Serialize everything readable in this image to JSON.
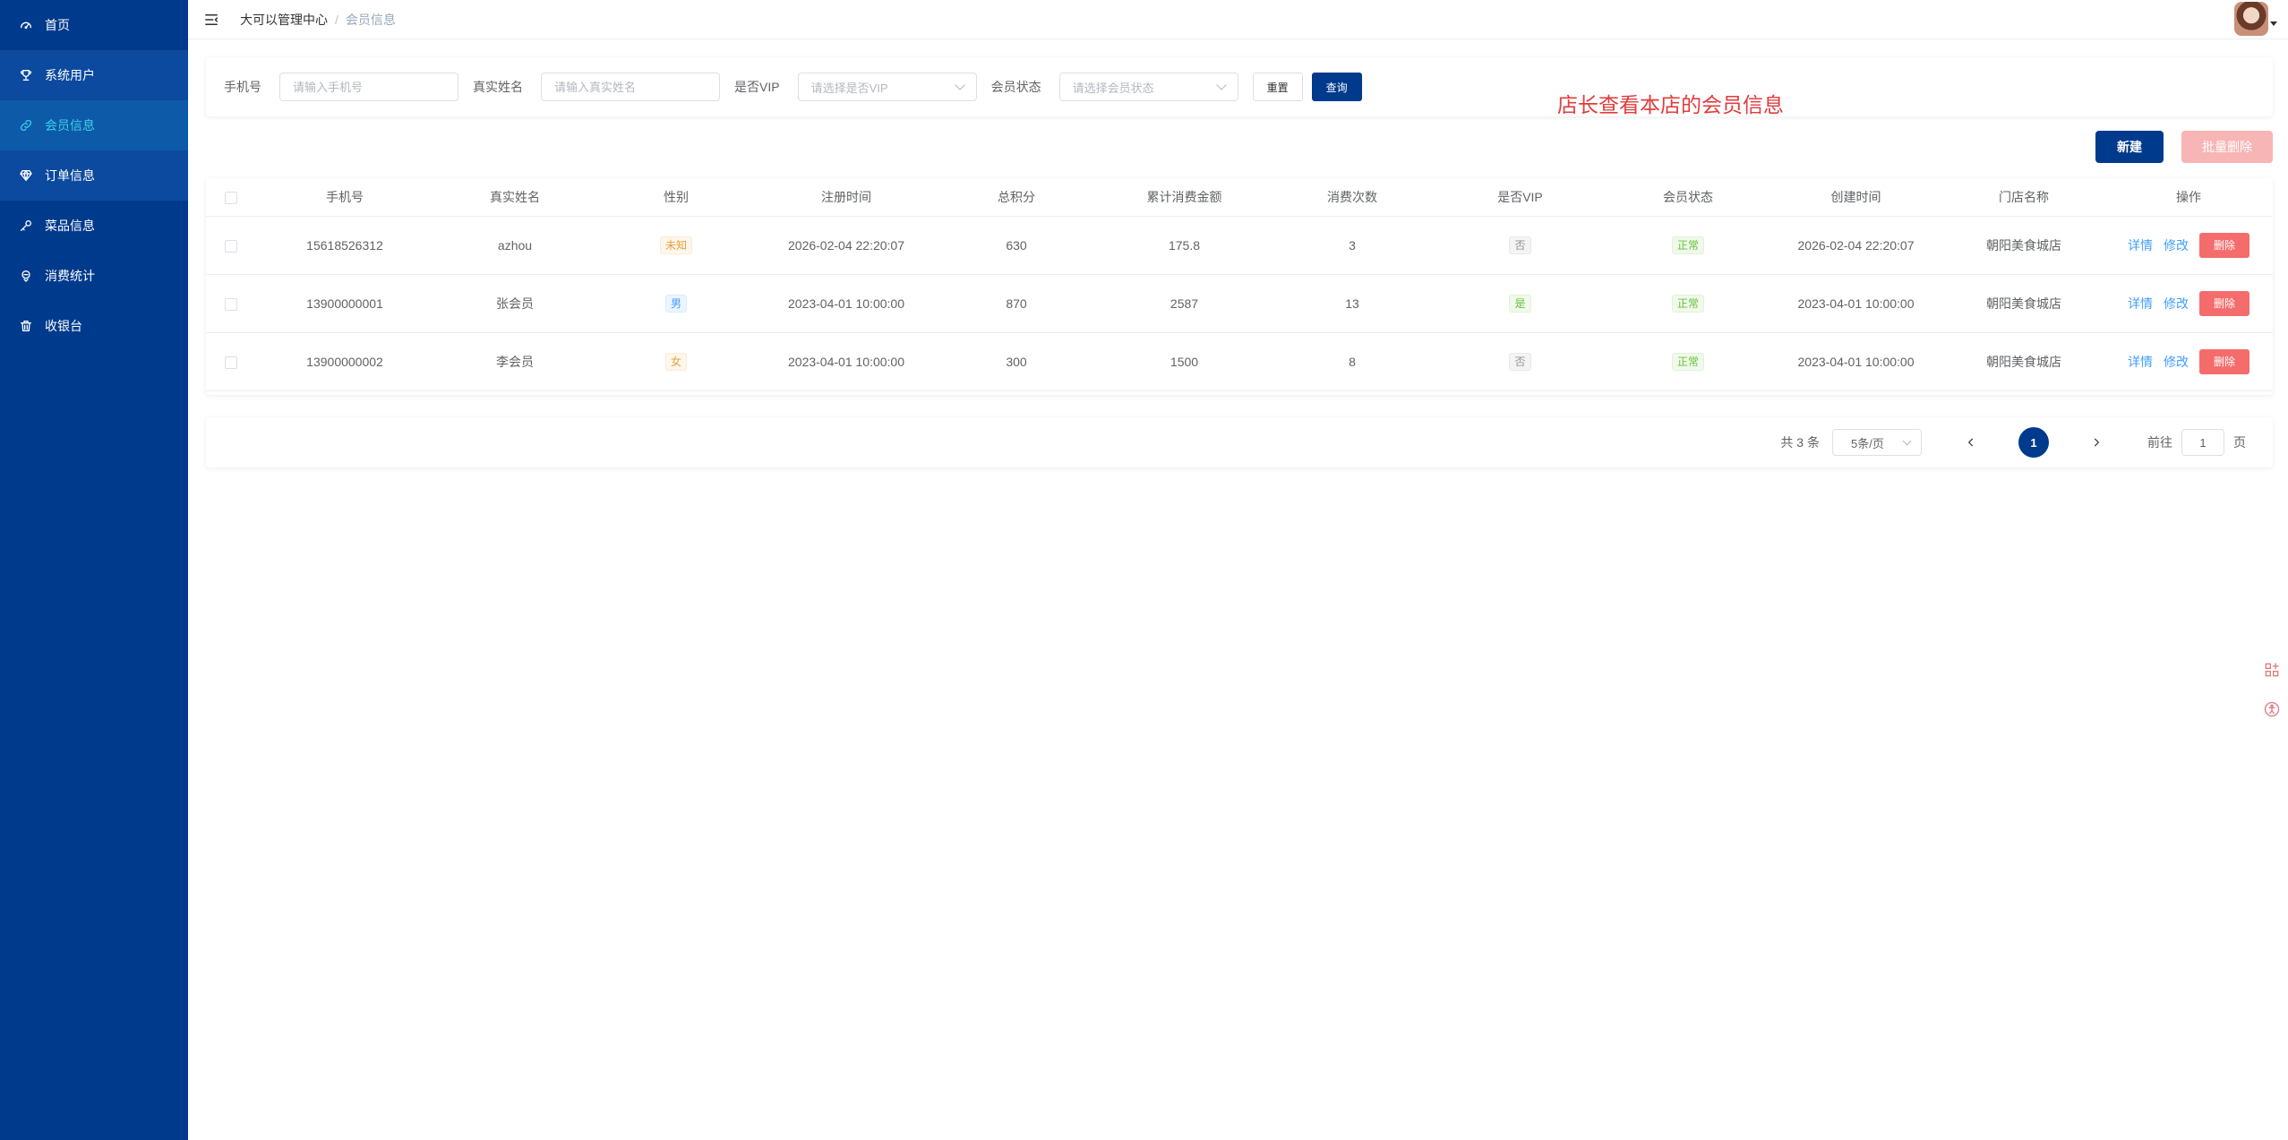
{
  "sidebar": {
    "items": [
      {
        "label": "首页",
        "icon": "dashboard-icon"
      },
      {
        "label": "系统用户",
        "icon": "trophy-icon"
      },
      {
        "label": "会员信息",
        "icon": "link-icon"
      },
      {
        "label": "订单信息",
        "icon": "diamond-icon"
      },
      {
        "label": "菜品信息",
        "icon": "key-icon"
      },
      {
        "label": "消费统计",
        "icon": "chart-icon"
      },
      {
        "label": "收银台",
        "icon": "trash-icon"
      }
    ]
  },
  "header": {
    "breadcrumb_root": "大可以管理中心",
    "breadcrumb_sep": "/",
    "breadcrumb_current": "会员信息"
  },
  "search": {
    "phone_label": "手机号",
    "phone_placeholder": "请输入手机号",
    "name_label": "真实姓名",
    "name_placeholder": "请输入真实姓名",
    "vip_label": "是否VIP",
    "vip_placeholder": "请选择是否VIP",
    "status_label": "会员状态",
    "status_placeholder": "请选择会员状态",
    "reset_label": "重置",
    "query_label": "查询"
  },
  "notice": "店长查看本店的会员信息",
  "actions": {
    "new_label": "新建",
    "batch_delete_label": "批量删除"
  },
  "table": {
    "columns": [
      "手机号",
      "真实姓名",
      "性别",
      "注册时间",
      "总积分",
      "累计消费金额",
      "消费次数",
      "是否VIP",
      "会员状态",
      "创建时间",
      "门店名称",
      "操作"
    ],
    "rows": [
      {
        "phone": "15618526312",
        "name": "azhou",
        "gender": "未知",
        "reg_time": "2026-02-04 22:20:07",
        "points": "630",
        "total_spend": "175.8",
        "visits": "3",
        "vip": "否",
        "status": "正常",
        "created": "2026-02-04 22:20:07",
        "store": "朝阳美食城店"
      },
      {
        "phone": "13900000001",
        "name": "张会员",
        "gender": "男",
        "reg_time": "2023-04-01 10:00:00",
        "points": "870",
        "total_spend": "2587",
        "visits": "13",
        "vip": "是",
        "status": "正常",
        "created": "2023-04-01 10:00:00",
        "store": "朝阳美食城店"
      },
      {
        "phone": "13900000002",
        "name": "李会员",
        "gender": "女",
        "reg_time": "2023-04-01 10:00:00",
        "points": "300",
        "total_spend": "1500",
        "visits": "8",
        "vip": "否",
        "status": "正常",
        "created": "2023-04-01 10:00:00",
        "store": "朝阳美食城店"
      }
    ],
    "op_detail": "详情",
    "op_edit": "修改",
    "op_delete": "删除"
  },
  "pagination": {
    "total_text": "共 3 条",
    "page_size": "5条/页",
    "current_page": "1",
    "goto_label": "前往",
    "goto_value": "1",
    "page_suffix": "页"
  },
  "colors": {
    "sidebar_bg": "#003a8c",
    "primary": "#003a8c",
    "active_text": "#3fd0e8",
    "danger": "#f56c6c",
    "notice": "#e03c3c"
  }
}
